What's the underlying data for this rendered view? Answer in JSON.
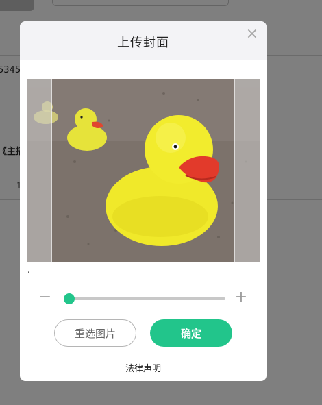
{
  "background": {
    "partial_number": "5345",
    "partial_title": "《主播",
    "partial_digit": "1"
  },
  "dialog": {
    "title": "上传封面",
    "close_symbol": "×",
    "comma": ",",
    "zoom": {
      "minus_symbol": "−",
      "plus_symbol": "+",
      "level": 0.0
    },
    "reselect_label": "重选图片",
    "confirm_label": "确定",
    "legal_label": "法律声明"
  },
  "colors": {
    "accent": "#22c58b",
    "overlay": "rgba(0,0,0,0.5)"
  }
}
